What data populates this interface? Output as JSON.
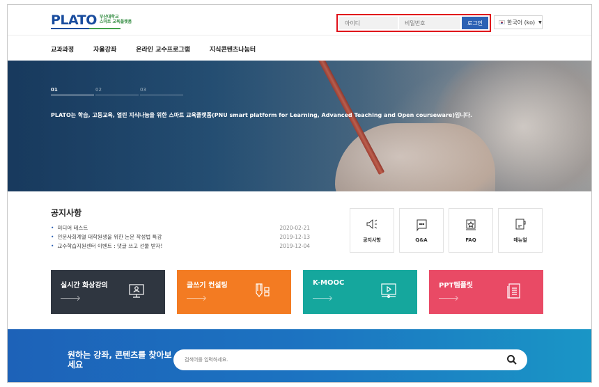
{
  "header": {
    "logo_main": "PLATO",
    "logo_sub_1": "부산대학교",
    "logo_sub_2": "스마트 교육플랫폼",
    "login": {
      "id_placeholder": "아이디",
      "pw_placeholder": "비밀번호",
      "button": "로그인"
    },
    "language": "한국어 (ko)"
  },
  "nav": {
    "items": [
      "교과과정",
      "자율강좌",
      "온라인 교수프로그램",
      "지식콘텐츠나눔터"
    ]
  },
  "hero": {
    "slides": [
      "01",
      "02",
      "03"
    ],
    "active_slide": "01",
    "text": "PLATO는 학습, 고등교육, 열린 지식나눔을 위한 스마트 교육플랫폼(PNU smart platform for Learning, Advanced Teaching and Open courseware)입니다."
  },
  "notice": {
    "title": "공지사항",
    "items": [
      {
        "title": "미디어 테스트",
        "date": "2020-02-21"
      },
      {
        "title": "인문사회계열 대학원생을 위한 논문 작성법 특강",
        "date": "2019-12-13"
      },
      {
        "title": "교수학습지원센터 이벤트 : 댓글 쓰고 선물 받자!",
        "date": "2019-12-04"
      }
    ]
  },
  "quick_links": [
    {
      "label": "공지사항",
      "icon": "megaphone-icon"
    },
    {
      "label": "Q&A",
      "icon": "chat-bubble-icon"
    },
    {
      "label": "FAQ",
      "icon": "star-board-icon"
    },
    {
      "label": "매뉴얼",
      "icon": "manual-icon"
    }
  ],
  "cards": [
    {
      "label": "실시간 화상강의",
      "color": "#2f3640",
      "icon": "video-lecture-icon"
    },
    {
      "label": "글쓰기 컨설팅",
      "color": "#f37b22",
      "icon": "writing-icon"
    },
    {
      "label": "K-MOOC",
      "color": "#15a79d",
      "icon": "play-screen-icon"
    },
    {
      "label": "PPT템플릿",
      "color": "#e94a65",
      "icon": "document-list-icon"
    }
  ],
  "search": {
    "title": "원하는 강좌, 콘텐츠를 찾아보세요",
    "placeholder": "검색어를 입력하세요."
  }
}
